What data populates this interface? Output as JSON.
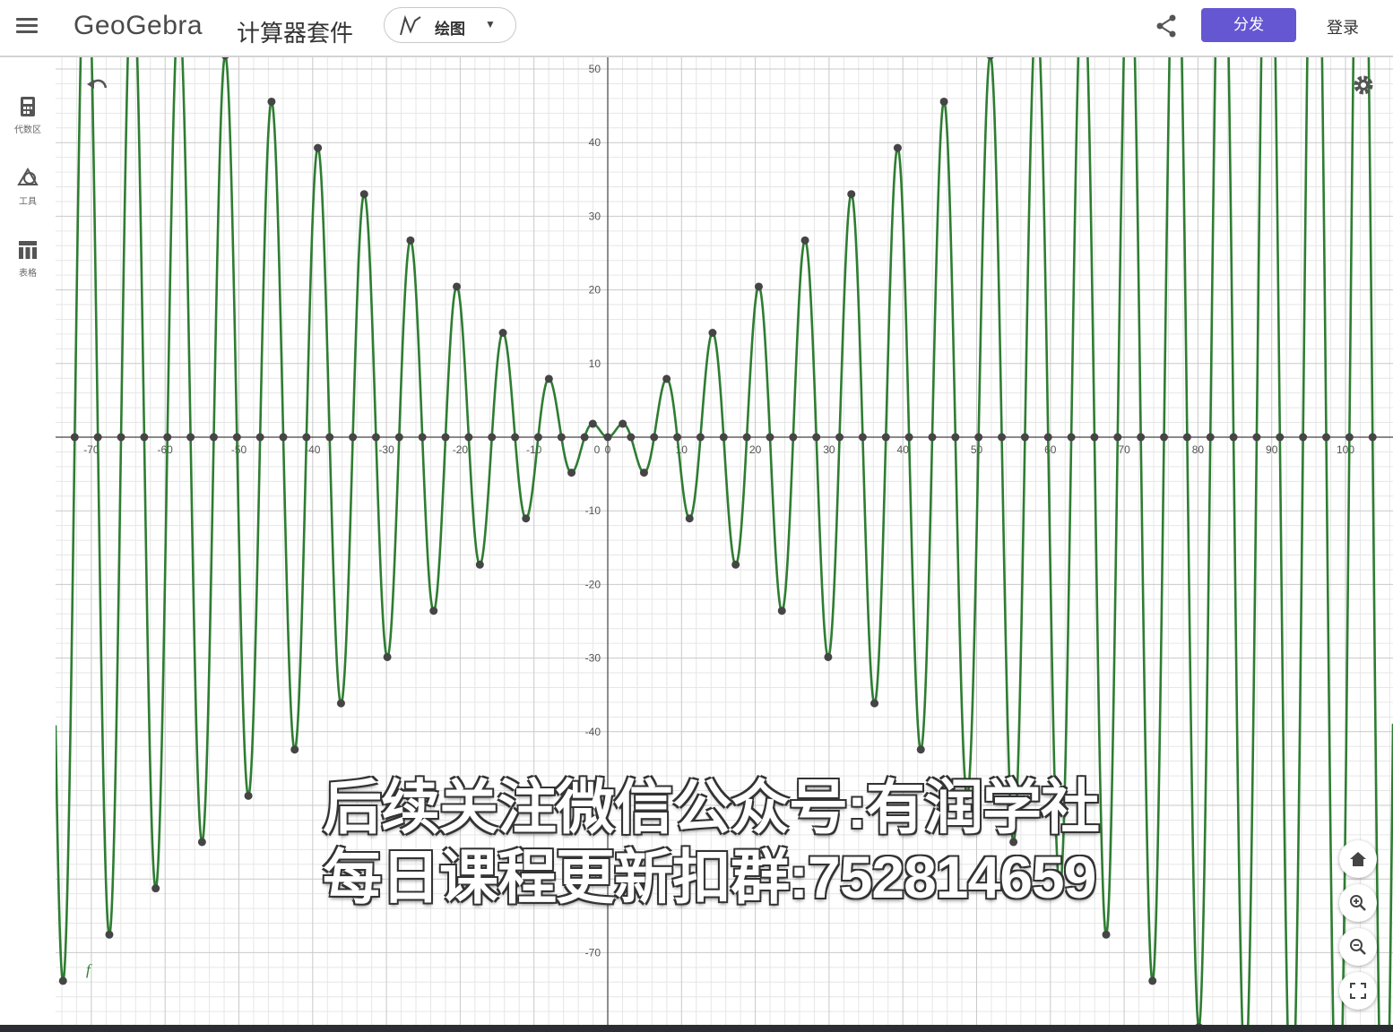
{
  "app": {
    "logo": "GeoGebra",
    "name": "计算器套件",
    "mode_label": "绘图",
    "share_primary_label": "分发",
    "login_label": "登录",
    "accent_color": "#6557d2"
  },
  "sidebar": {
    "items": [
      {
        "icon": "calculator-icon",
        "label": "代数区"
      },
      {
        "icon": "tools-icon",
        "label": "工具"
      },
      {
        "icon": "table-icon",
        "label": "表格"
      }
    ]
  },
  "graph": {
    "function_label": "f",
    "curve_color": "#2e7d32"
  },
  "watermark": {
    "line1": "后续关注微信公众号:有润学社",
    "line2": "每日课程更新扣群:752814659"
  },
  "chart_data": {
    "type": "line",
    "function": "x·sin(x)",
    "series": [
      {
        "name": "f",
        "color": "#2e7d32"
      }
    ],
    "xlim": [
      -75,
      106
    ],
    "ylim": [
      -78,
      51
    ],
    "x_ticks": [
      -70,
      -60,
      -50,
      -40,
      -30,
      -20,
      -10,
      0,
      10,
      20,
      30,
      40,
      50,
      60,
      70,
      80,
      90,
      100
    ],
    "y_ticks": [
      50,
      40,
      30,
      20,
      10,
      -10,
      -20,
      -30,
      -40,
      -50,
      -60,
      -70
    ],
    "grid": true,
    "points": "roots and extrema of f marked on curve"
  }
}
